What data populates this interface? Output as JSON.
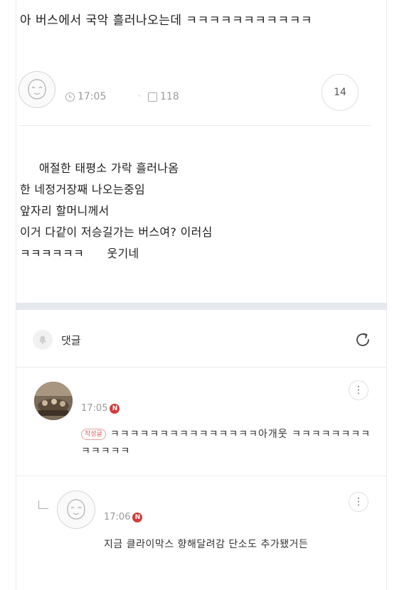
{
  "post": {
    "title": "아 버스에서         국악 흘러나오는데 ㅋㅋㅋㅋㅋㅋㅋㅋㅋㅋㅋ",
    "time": "17:05",
    "views": "118",
    "comment_count": "14",
    "body_lines": [
      "     애절한 태평소 가락 흘러나옴",
      "한 네정거장째 나오는중임",
      "앞자리 할머니께서",
      "이거 다같이 저승길가는 버스여? 이러심",
      "ㅋㅋㅋㅋㅋㅋ      웃기네"
    ]
  },
  "comments_section": {
    "label": "댓글"
  },
  "comments": [
    {
      "time": "17:05",
      "new_badge": "N",
      "author_badge": "작성글",
      "text": "ㅋㅋㅋㅋㅋㅋㅋㅋㅋㅋㅋㅋㅋㅋㅋ아개웃   ㅋㅋㅋㅋㅋㅋㅋㅋㅋㅋㅋㅋㅋ"
    },
    {
      "time": "17:06",
      "new_badge": "N",
      "text": "지금 클라이막스 향해달려감 단소도 추가됐거든"
    }
  ],
  "colors": {
    "section_bar": "#e5e8ec",
    "new_badge": "#d23c3c",
    "text": "#1e1e1e",
    "meta": "#9a9a9a"
  },
  "icons": {
    "clock": "clock-icon",
    "views": "views-icon",
    "bell": "bell-icon",
    "refresh": "refresh-icon",
    "more": "more-vertical-icon",
    "reply": "reply-arrow-icon"
  }
}
